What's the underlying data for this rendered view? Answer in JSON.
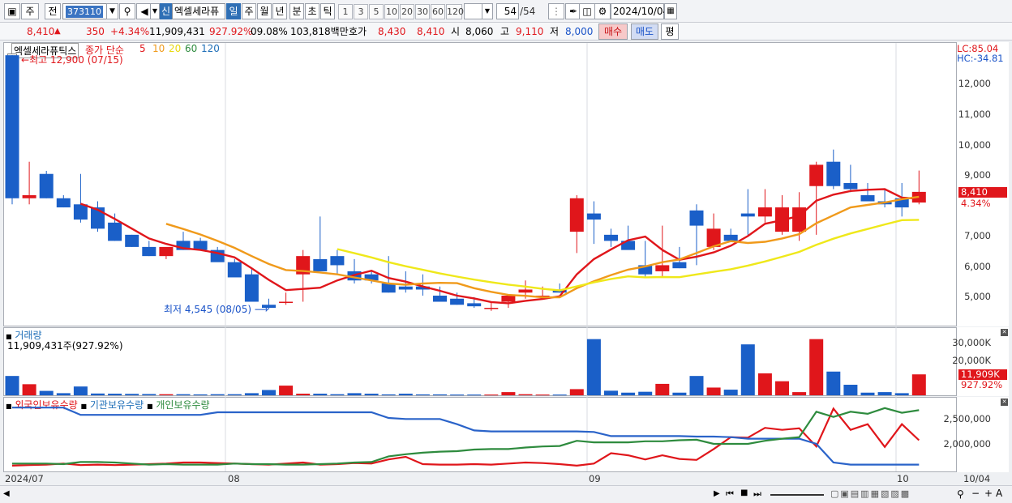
{
  "toolbar": {
    "mode_label": "주",
    "prev_label": "전",
    "code_value": "373110",
    "sin_label": "신",
    "stock_name": "엑셀세라퓨",
    "period_tabs": [
      "일",
      "주",
      "월",
      "년",
      "분",
      "초",
      "틱"
    ],
    "active_period": "일",
    "interval_buttons": [
      "1",
      "3",
      "5",
      "10",
      "20",
      "30",
      "60",
      "120"
    ],
    "count_value": "54",
    "count_total": "/54",
    "date_value": "2024/10/04"
  },
  "quote": {
    "price": "8,410",
    "change": "350",
    "change_pct": "+4.34%",
    "volume": "11,909,431",
    "volume_pct": "927.92%",
    "turnover_pct": "09.08%",
    "amount": "103,818백만",
    "ask_label": "호가",
    "ask": "8,430",
    "bid": "8,410",
    "open_label": "시",
    "open": "8,060",
    "high_label": "고",
    "high": "9,110",
    "low_label": "저",
    "low": "8,000",
    "buy_label": "매수",
    "sell_label": "매도",
    "eval_label": "평"
  },
  "price_panel": {
    "name_tag": "엑셀세라퓨틱스",
    "indicator_label": "종가 단순",
    "ma_labels": [
      "5",
      "10",
      "20",
      "60",
      "120"
    ],
    "high_marker": "최고 12,900 (07/15)",
    "low_marker": "최저 4,545 (08/05)",
    "lc": "LC:85.04",
    "hc": "HC:-34.81",
    "last_price_tag": "8,410",
    "last_pct_tag": "4.34%",
    "y_ticks": [
      "12,000",
      "11,000",
      "10,000",
      "9,000",
      "8,000",
      "7,000",
      "6,000",
      "5,000"
    ]
  },
  "volume_panel": {
    "title": "거래량",
    "value_text": "11,909,431주(927.92%)",
    "y_ticks": [
      "30,000K",
      "20,000K"
    ],
    "last_tag": "11,909K",
    "last_pct": "927.92%"
  },
  "holding_panel": {
    "legend": [
      "외국인보유수량",
      "기관보유수량",
      "개인보유수량"
    ],
    "y_ticks": [
      "2,500,000",
      "2,000,000"
    ]
  },
  "x_labels": [
    "2024/07",
    "08",
    "09",
    "10",
    "10/04"
  ],
  "chart_data": {
    "type": "candlestick",
    "dates": [
      "07/15",
      "07/16",
      "07/17",
      "07/18",
      "07/19",
      "07/22",
      "07/23",
      "07/24",
      "07/25",
      "07/26",
      "07/29",
      "07/30",
      "07/31",
      "08/01",
      "08/02",
      "08/05",
      "08/06",
      "08/07",
      "08/08",
      "08/09",
      "08/12",
      "08/13",
      "08/14",
      "08/16",
      "08/19",
      "08/20",
      "08/21",
      "08/22",
      "08/23",
      "08/26",
      "08/27",
      "08/28",
      "08/29",
      "08/30",
      "09/02",
      "09/03",
      "09/04",
      "09/05",
      "09/06",
      "09/09",
      "09/10",
      "09/11",
      "09/12",
      "09/13",
      "09/19",
      "09/20",
      "09/23",
      "09/24",
      "09/25",
      "09/26",
      "09/27",
      "09/30",
      "10/02",
      "10/04"
    ],
    "open": [
      12900,
      8200,
      9000,
      8200,
      8000,
      7900,
      7400,
      7000,
      6600,
      6300,
      6800,
      6800,
      6500,
      6100,
      5700,
      4700,
      4800,
      5700,
      6200,
      6300,
      5800,
      5700,
      5400,
      5300,
      5300,
      5000,
      4900,
      4750,
      4600,
      4800,
      5100,
      5000,
      5200,
      7100,
      7700,
      7000,
      6800,
      6000,
      5800,
      6100,
      7800,
      6600,
      7000,
      7700,
      7600,
      7100,
      7100,
      8600,
      9400,
      8700,
      8300,
      8100,
      8200,
      8060
    ],
    "high": [
      12900,
      9400,
      9100,
      8300,
      9000,
      8100,
      7700,
      7000,
      6800,
      6500,
      7100,
      6900,
      6600,
      6200,
      5900,
      4900,
      5100,
      6500,
      7600,
      6500,
      6200,
      5800,
      6300,
      5800,
      5700,
      5300,
      5100,
      4950,
      4800,
      5000,
      5500,
      5300,
      5400,
      8300,
      8100,
      7200,
      7300,
      6800,
      7300,
      6600,
      8000,
      7700,
      7200,
      8500,
      8500,
      8300,
      8400,
      9400,
      9800,
      9300,
      8700,
      8500,
      8700,
      9110
    ],
    "low": [
      8000,
      8000,
      8200,
      7900,
      7400,
      7100,
      6800,
      6600,
      6300,
      6200,
      6500,
      6500,
      6200,
      5800,
      4900,
      4545,
      4700,
      4800,
      5800,
      5700,
      5400,
      5400,
      5100,
      5100,
      5000,
      4850,
      4700,
      4600,
      4500,
      4600,
      4900,
      4900,
      5100,
      6400,
      6700,
      6600,
      6700,
      5600,
      5600,
      5900,
      6000,
      6500,
      6800,
      7000,
      7400,
      7000,
      6800,
      7000,
      8500,
      8400,
      8100,
      7900,
      7600,
      8000
    ],
    "close": [
      8200,
      8300,
      8200,
      7900,
      7500,
      7200,
      6800,
      6600,
      6300,
      6600,
      6500,
      6500,
      6100,
      5600,
      4800,
      4600,
      4800,
      6300,
      5800,
      6000,
      5500,
      5500,
      5100,
      5200,
      5200,
      4800,
      4700,
      4650,
      4600,
      5000,
      5200,
      5000,
      5100,
      8200,
      7500,
      6800,
      6500,
      5700,
      6000,
      5900,
      7300,
      7200,
      6800,
      7600,
      7900,
      7900,
      7900,
      9300,
      8600,
      8500,
      8100,
      8000,
      7900,
      8410
    ],
    "volume_k": [
      11000,
      6300,
      2500,
      1200,
      5000,
      1000,
      900,
      800,
      700,
      600,
      600,
      500,
      600,
      600,
      1200,
      3000,
      5500,
      900,
      900,
      600,
      1200,
      900,
      500,
      900,
      500,
      500,
      400,
      400,
      400,
      1800,
      600,
      400,
      400,
      3500,
      32000,
      2600,
      1500,
      2000,
      6500,
      1500,
      11000,
      4400,
      3200,
      29000,
      12500,
      8000,
      1800,
      32000,
      13500,
      6000,
      1500,
      1800,
      1200,
      11909
    ],
    "ylim": [
      4200,
      13000
    ]
  }
}
